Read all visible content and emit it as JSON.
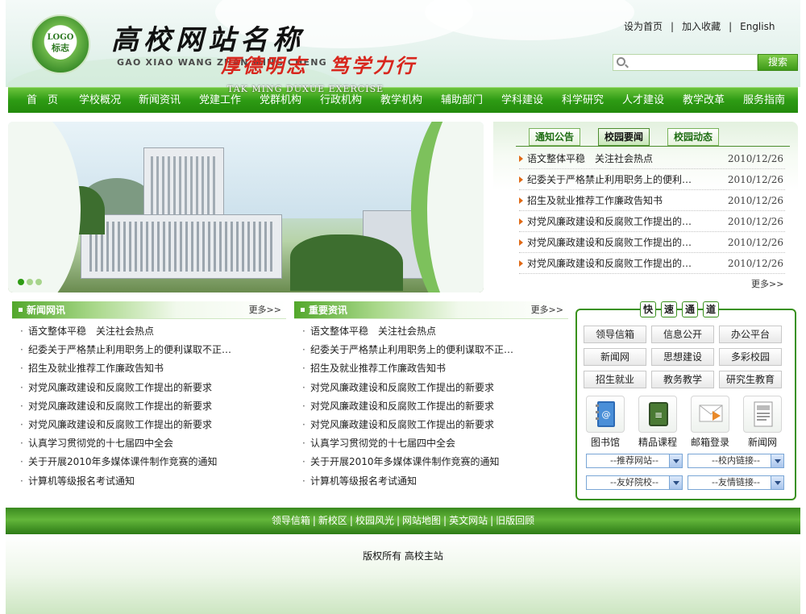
{
  "header": {
    "logo": {
      "line1": "LOGO",
      "line2": "标志"
    },
    "title": "高校网站名称",
    "pinyin": "GAO XIAO WANG ZHAN MING CHENG",
    "links": [
      "设为首页",
      "加入收藏",
      "English"
    ],
    "link_sep": "|",
    "search_placeholder": "",
    "search_button": "搜索"
  },
  "nav": [
    "首　页",
    "学校概况",
    "新闻资讯",
    "党建工作",
    "党群机构",
    "行政机构",
    "教学机构",
    "辅助部门",
    "学科建设",
    "科学研究",
    "人才建设",
    "教学改革",
    "服务指南"
  ],
  "banner": {
    "slogan": "厚德明志　笃学力行",
    "slogan_en": "TAK MING DUXUE EXERCISE",
    "dots": 3,
    "active_dot": 0
  },
  "notice": {
    "tabs": [
      "通知公告",
      "校园要闻",
      "校园动态"
    ],
    "active_tab": 1,
    "items": [
      {
        "title": "语文整体平稳　关注社会热点",
        "date": "2010/12/26"
      },
      {
        "title": "纪委关于严格禁止利用职务上的便利…",
        "date": "2010/12/26"
      },
      {
        "title": "招生及就业推荐工作廉政告知书",
        "date": "2010/12/26"
      },
      {
        "title": "对党风廉政建设和反腐败工作提出的…",
        "date": "2010/12/26"
      },
      {
        "title": "对党风廉政建设和反腐败工作提出的…",
        "date": "2010/12/26"
      },
      {
        "title": "对党风廉政建设和反腐败工作提出的…",
        "date": "2010/12/26"
      }
    ],
    "more": "更多>>"
  },
  "news": {
    "title": "新闻网讯",
    "more": "更多>>",
    "items": [
      "语文整体平稳　关注社会热点",
      "纪委关于严格禁止利用职务上的便利谋取不正…",
      "招生及就业推荐工作廉政告知书",
      "对党风廉政建设和反腐败工作提出的新要求",
      "对党风廉政建设和反腐败工作提出的新要求",
      "对党风廉政建设和反腐败工作提出的新要求",
      "认真学习贯彻党的十七届四中全会",
      "关于开展2010年多媒体课件制作竞赛的通知",
      "计算机等级报名考试通知"
    ]
  },
  "important": {
    "title": "重要资讯",
    "more": "更多>>",
    "items": [
      "语文整体平稳　关注社会热点",
      "纪委关于严格禁止利用职务上的便利谋取不正…",
      "招生及就业推荐工作廉政告知书",
      "对党风廉政建设和反腐败工作提出的新要求",
      "对党风廉政建设和反腐败工作提出的新要求",
      "对党风廉政建设和反腐败工作提出的新要求",
      "认真学习贯彻党的十七届四中全会",
      "关于开展2010年多媒体课件制作竞赛的通知",
      "计算机等级报名考试通知"
    ]
  },
  "quick": {
    "title": [
      "快",
      "速",
      "通",
      "道"
    ],
    "buttons": [
      "领导信箱",
      "信息公开",
      "办公平台",
      "新闻网",
      "思想建设",
      "多彩校园",
      "招生就业",
      "教务教学",
      "研究生教育"
    ],
    "icons": [
      {
        "label": "图书馆",
        "icon": "address-book-icon"
      },
      {
        "label": "精品课程",
        "icon": "course-icon"
      },
      {
        "label": "邮箱登录",
        "icon": "mail-icon"
      },
      {
        "label": "新闻网",
        "icon": "newspaper-icon"
      }
    ],
    "selects": [
      "--推荐网站--",
      "--校内链接--",
      "--友好院校--",
      "--友情链接--"
    ]
  },
  "footer": {
    "links": [
      "领导信箱",
      "新校区",
      "校园风光",
      "网站地图",
      "英文网站",
      "旧版回顾"
    ],
    "sep": "|",
    "copyright": "版权所有 高校主站"
  },
  "colors": {
    "brand_green": "#2e9b14",
    "accent_orange": "#e06a16"
  }
}
